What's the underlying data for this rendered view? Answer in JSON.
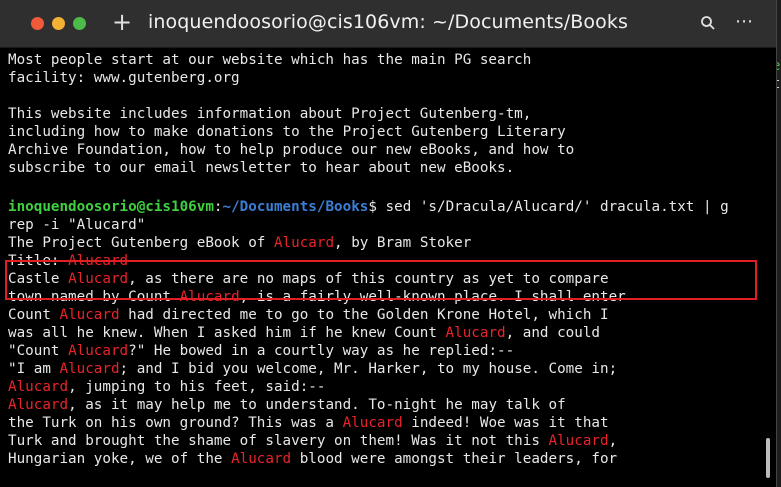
{
  "window": {
    "title": "inoquendoosorio@cis106vm: ~/Documents/Books",
    "new_tab_label": "+",
    "menu_label": "⋯"
  },
  "background": {
    "fragment_1": "e",
    "fragment_2": "t"
  },
  "terminal": {
    "text_lines": [
      "Most people start at our website which has the main PG search",
      "facility: www.gutenberg.org",
      "",
      "This website includes information about Project Gutenberg-tm,",
      "including how to make donations to the Project Gutenberg Literary",
      "Archive Foundation, how to help produce our new eBooks, and how to",
      "subscribe to our email newsletter to hear about new eBooks.",
      ""
    ],
    "prompt": {
      "user_host": "inoquendoosorio@cis106vm",
      "sep": ":",
      "path": "~/Documents/Books",
      "symbol": "$",
      "command_line1": " sed 's/Dracula/Alucard/' dracula.txt | g",
      "command_line2": "rep -i \"Alucard\""
    },
    "results": [
      [
        "The Project Gutenberg eBook of ",
        "Alucard",
        ", by Bram Stoker"
      ],
      [
        "Title: ",
        "Alucard"
      ],
      [
        "Castle ",
        "Alucard",
        ", as there are no maps of this country as yet to compare"
      ],
      [
        "town named by Count ",
        "Alucard",
        ", is a fairly well-known place. I shall enter"
      ],
      [
        "Count ",
        "Alucard",
        " had directed me to go to the Golden Krone Hotel, which I"
      ],
      [
        "was all he knew. When I asked him if he knew Count ",
        "Alucard",
        ", and could"
      ],
      [
        "\"Count ",
        "Alucard",
        "?\" He bowed in a courtly way as he replied:--"
      ],
      [
        "\"I am ",
        "Alucard",
        "; and I bid you welcome, Mr. Harker, to my house. Come in;"
      ],
      [
        "",
        "Alucard",
        ", jumping to his feet, said:--"
      ],
      [
        "",
        "Alucard",
        ", as it may help me to understand. To-night he may talk of"
      ],
      [
        "the Turk on his own ground? This was a ",
        "Alucard",
        " indeed! Woe was it that"
      ],
      [
        "Turk and brought the shame of slavery on them! Was it not this ",
        "Alucard",
        ","
      ],
      [
        "Hungarian yoke, we of the ",
        "Alucard",
        " blood were amongst their leaders, for"
      ]
    ]
  },
  "colors": {
    "match": "#e8242a",
    "user_host": "#3fd13f",
    "path": "#3a7fd6",
    "highlight_box": "#e01e24"
  }
}
